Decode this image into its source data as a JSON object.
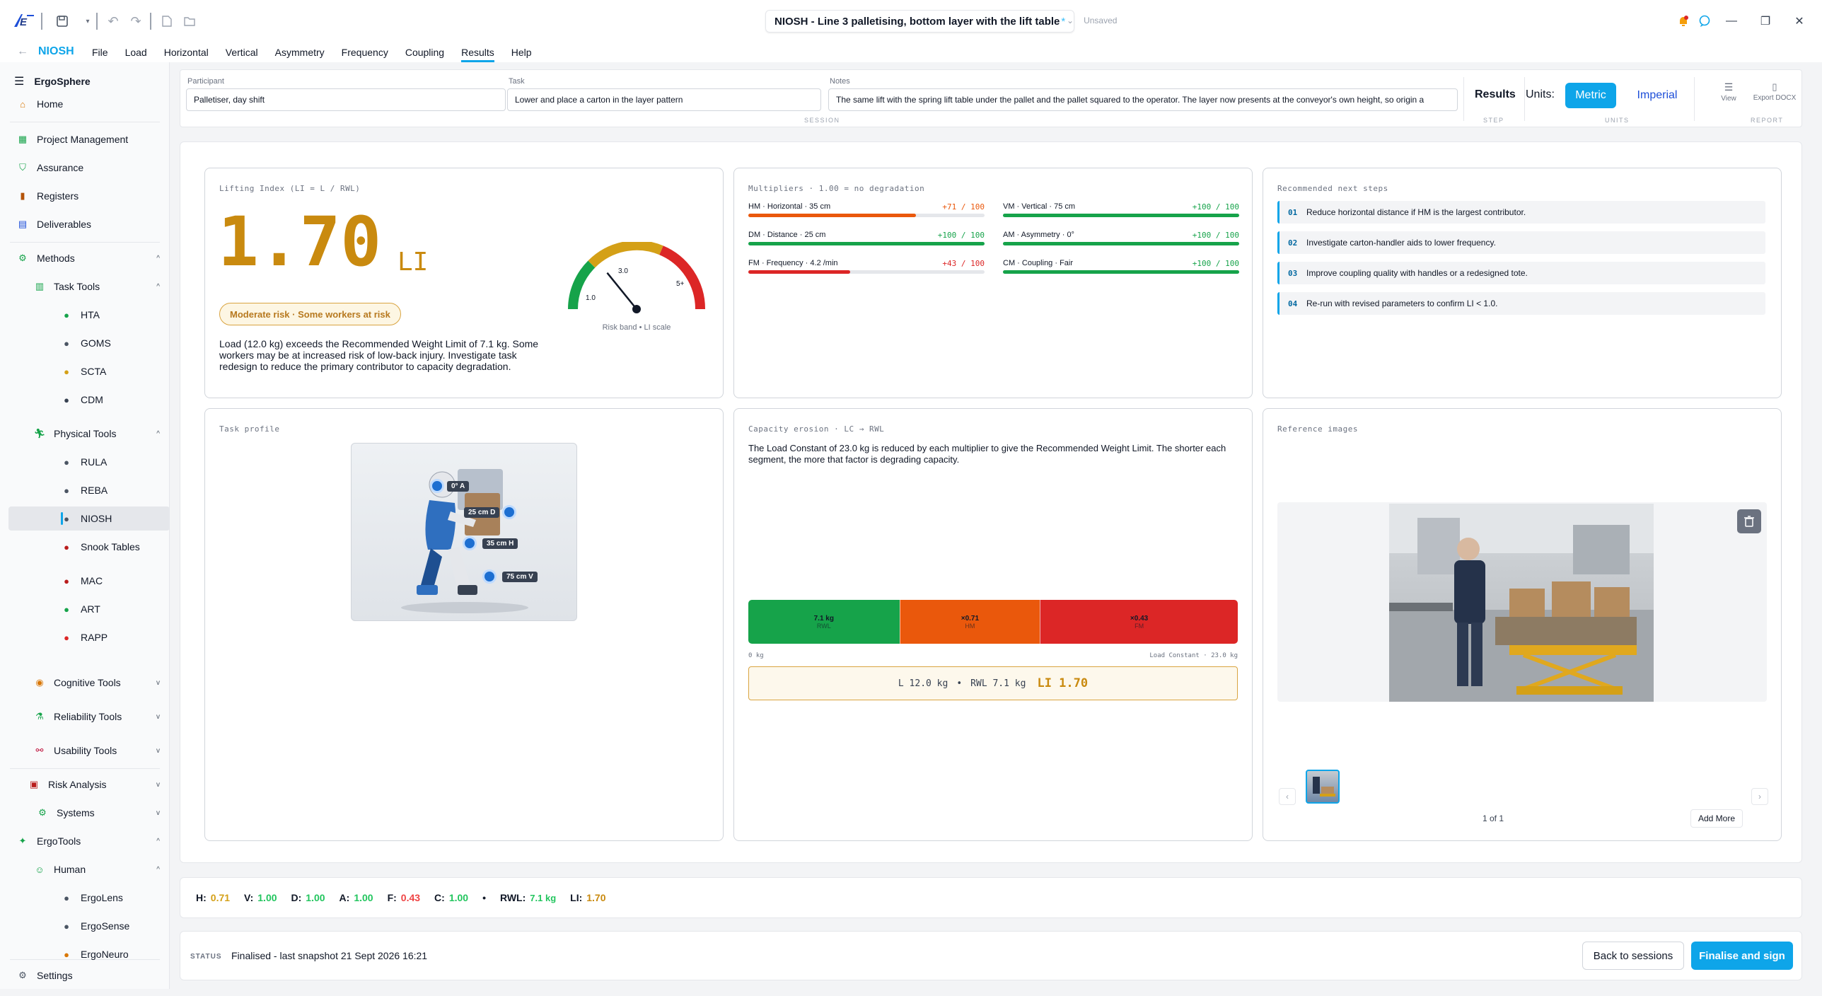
{
  "app": {
    "name": "NIOSH",
    "doc_title": "NIOSH - Line 3 palletising, bottom layer with the lift table",
    "dirty_marker": "*",
    "save_state": "Unsaved"
  },
  "menu": [
    "File",
    "Load",
    "Horizontal",
    "Vertical",
    "Asymmetry",
    "Frequency",
    "Coupling",
    "Results",
    "Help"
  ],
  "menu_active": "Results",
  "sidebar": {
    "brand": "ErgoSphere",
    "home": "Home",
    "project_management": "Project Management",
    "assurance": "Assurance",
    "registers": "Registers",
    "deliverables": "Deliverables",
    "methods": "Methods",
    "task_tools": "Task Tools",
    "task_items": [
      "HTA",
      "GOMS",
      "SCTA",
      "CDM"
    ],
    "physical_tools": "Physical Tools",
    "physical_items": [
      "RULA",
      "REBA",
      "NIOSH",
      "Snook Tables",
      "MAC",
      "ART",
      "RAPP"
    ],
    "cognitive_tools": "Cognitive Tools",
    "reliability_tools": "Reliability Tools",
    "usability_tools": "Usability Tools",
    "risk_analysis": "Risk Analysis",
    "systems": "Systems",
    "ergotools": "ErgoTools",
    "human": "Human",
    "human_items": [
      "ErgoLens",
      "ErgoSense",
      "ErgoNeuro"
    ],
    "settings": "Settings"
  },
  "session": {
    "participant_label": "Participant",
    "participant_value": "Palletiser, day shift",
    "task_label": "Task",
    "task_value": "Lower and place a carton in the layer pattern",
    "notes_label": "Notes",
    "notes_value": "The same lift with the spring lift table under the pallet and the pallet squared to the operator. The layer now presents at the conveyor's own height, so origin a",
    "session_caption": "SESSION",
    "step_value": "Results",
    "step_caption": "STEP",
    "units_label": "Units:",
    "unit_metric": "Metric",
    "unit_imperial": "Imperial",
    "units_caption": "UNITS",
    "view_label": "View",
    "export_label": "Export DOCX",
    "report_caption": "REPORT"
  },
  "lifting_index": {
    "caption": "Lifting Index (LI = L / RWL)",
    "value": "1.70",
    "unit": "LI",
    "badge": "Moderate risk · Some workers at risk",
    "description": "Load (12.0 kg) exceeds the Recommended Weight Limit of 7.1 kg. Some workers may be at increased risk of low-back injury. Investigate task redesign to reduce the primary contributor to capacity degradation.",
    "gauge": {
      "labels": [
        "1.0",
        "3.0",
        "5+"
      ],
      "caption": "Risk band • LI scale",
      "needle_value": 1.7,
      "min": 0,
      "max": 6
    }
  },
  "multipliers": {
    "caption": "Multipliers · 1.00 = no degradation",
    "items": [
      {
        "label": "HM · Horizontal · 35 cm",
        "value_text": "+71 / 100",
        "fraction": 0.71,
        "color": "#ea580c",
        "text_color": "#ea580c"
      },
      {
        "label": "VM · Vertical · 75 cm",
        "value_text": "+100 / 100",
        "fraction": 1.0,
        "color": "#16a34a",
        "text_color": "#16a34a"
      },
      {
        "label": "DM · Distance · 25 cm",
        "value_text": "+100 / 100",
        "fraction": 1.0,
        "color": "#16a34a",
        "text_color": "#16a34a"
      },
      {
        "label": "AM · Asymmetry · 0°",
        "value_text": "+100 / 100",
        "fraction": 1.0,
        "color": "#16a34a",
        "text_color": "#16a34a"
      },
      {
        "label": "FM · Frequency · 4.2 /min",
        "value_text": "+43 / 100",
        "fraction": 0.43,
        "color": "#dc2626",
        "text_color": "#dc2626"
      },
      {
        "label": "CM · Coupling · Fair",
        "value_text": "+100 / 100",
        "fraction": 1.0,
        "color": "#16a34a",
        "text_color": "#16a34a"
      }
    ]
  },
  "next_steps": {
    "caption": "Recommended next steps",
    "items": [
      {
        "num": "01",
        "text": "Reduce horizontal distance if HM is the largest contributor."
      },
      {
        "num": "02",
        "text": "Investigate carton-handler aids to lower frequency."
      },
      {
        "num": "03",
        "text": "Improve coupling quality with handles or a redesigned tote."
      },
      {
        "num": "04",
        "text": "Re-run with revised parameters to confirm LI < 1.0."
      }
    ]
  },
  "task_profile": {
    "caption": "Task profile",
    "markers": [
      "0° A",
      "25 cm D",
      "35 cm H",
      "75 cm V"
    ]
  },
  "capacity": {
    "caption": "Capacity erosion · LC → RWL",
    "description": "The Load Constant of 23.0 kg is reduced by each multiplier to give the Recommended Weight Limit. The shorter each segment, the more that factor is degrading capacity.",
    "segments": [
      {
        "value": "7.1 kg",
        "name": "RWL",
        "share": 7.1,
        "color": "#16a34a"
      },
      {
        "value": "×0.71",
        "name": "HM",
        "share": 6.6,
        "color": "#ea580c"
      },
      {
        "value": "×0.43",
        "name": "FM",
        "share": 9.3,
        "color": "#dc2626"
      }
    ],
    "axis_min": "0 kg",
    "axis_max": "Load Constant · 23.0 kg",
    "summary_load": "L 12.0 kg",
    "summary_sep": "•",
    "summary_rwl": "RWL 7.1 kg",
    "summary_li": "LI 1.70"
  },
  "reference": {
    "caption": "Reference images",
    "counter": "1 of 1",
    "add_more": "Add More"
  },
  "summary": [
    {
      "k": "H:",
      "v": "0.71",
      "color": "#d4a017"
    },
    {
      "k": "V:",
      "v": "1.00",
      "color": "#22c55e"
    },
    {
      "k": "D:",
      "v": "1.00",
      "color": "#22c55e"
    },
    {
      "k": "A:",
      "v": "1.00",
      "color": "#22c55e"
    },
    {
      "k": "F:",
      "v": "0.43",
      "color": "#ef4444"
    },
    {
      "k": "C:",
      "v": "1.00",
      "color": "#22c55e"
    }
  ],
  "summary_dot": "•",
  "summary_rwl_k": "RWL:",
  "summary_rwl_v": "7.1 kg",
  "summary_li_k": "LI:",
  "summary_li_v": "1.70",
  "status": {
    "label": "STATUS",
    "text": "Finalised - last snapshot 21 Sept 2026 16:21",
    "back": "Back to sessions",
    "finalise": "Finalise and sign"
  },
  "colors": {
    "accent": "#0ea5e9",
    "li_amber": "#c98a0f",
    "ok": "#16a34a",
    "warn": "#ea580c",
    "danger": "#dc2626"
  }
}
